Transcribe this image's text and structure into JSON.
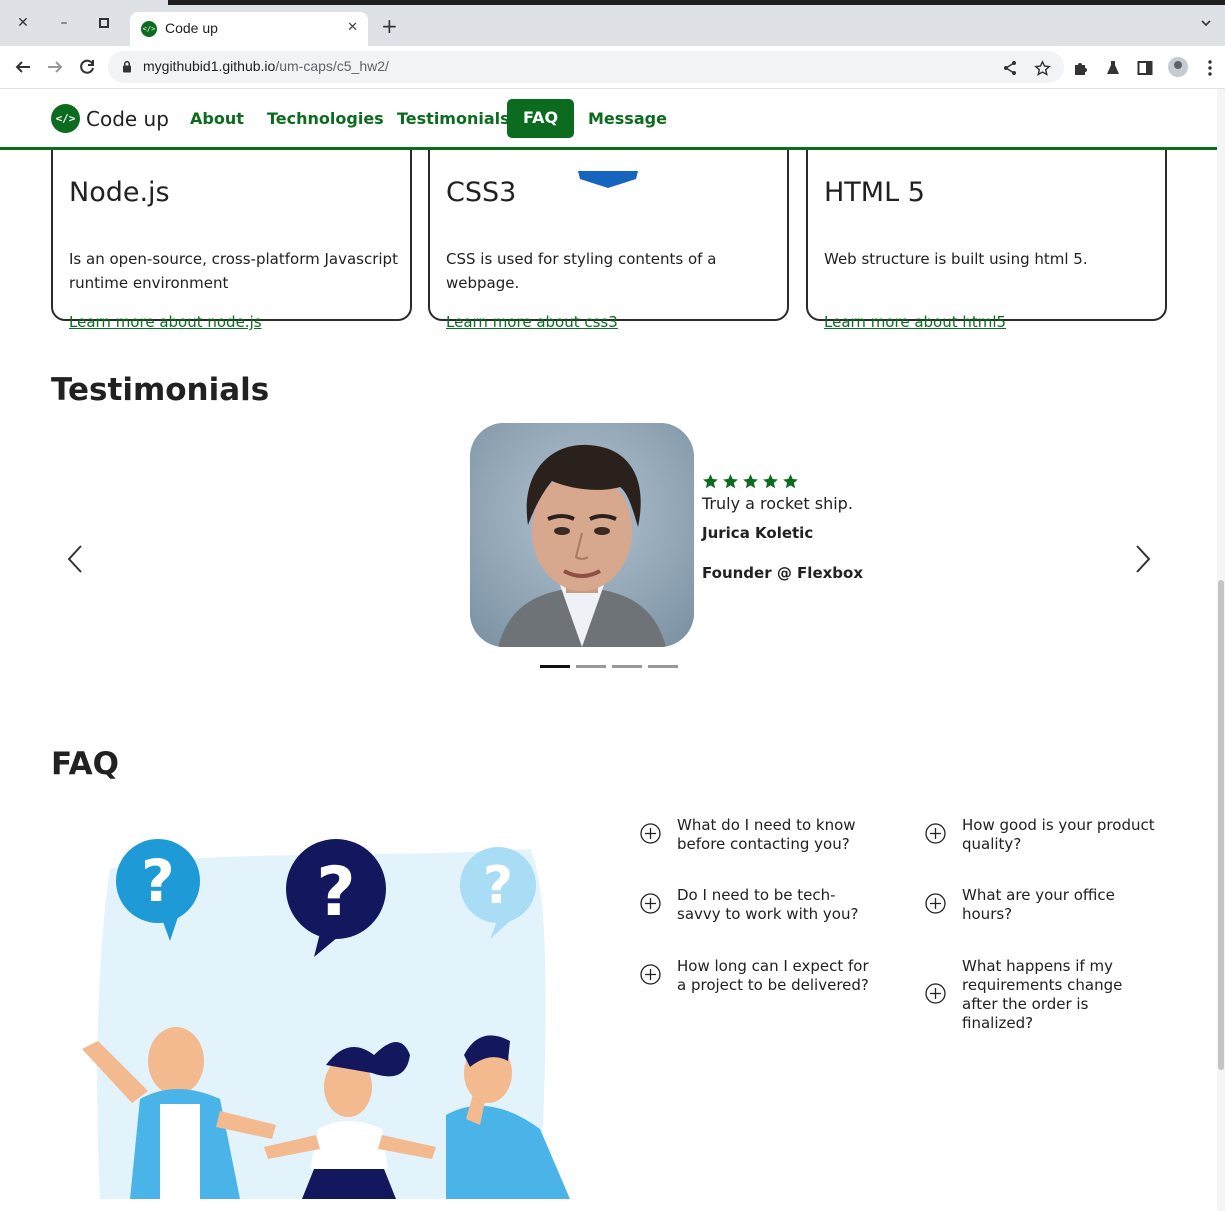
{
  "browser": {
    "tab_title": "Code up",
    "url_host": "mygithubid1.github.io",
    "url_path": "/um-caps/c5_hw2/"
  },
  "site": {
    "brand": "Code up",
    "brand_logo_text": "</>",
    "nav": [
      "About",
      "Technologies",
      "Testimonials",
      "FAQ",
      "Message"
    ],
    "active_nav": "FAQ",
    "accent": "#0b6b1f"
  },
  "technologies": [
    {
      "title": "Node.js",
      "description": "Is an open-source, cross-platform Javascript runtime environment",
      "link": "Learn more about node.js"
    },
    {
      "title": "CSS3",
      "description": "CSS is used for styling contents of a webpage.",
      "link": "Learn more about css3"
    },
    {
      "title": "HTML 5",
      "description": "Web structure is built using html 5.",
      "link": "Learn more about html5"
    }
  ],
  "testimonials": {
    "heading": "Testimonials",
    "rating": 5,
    "quote": "Truly a rocket ship.",
    "name": "Jurica Koletic",
    "role": "Founder @ Flexbox",
    "slide_count": 4,
    "active_slide": 1
  },
  "faq": {
    "heading": "FAQ",
    "questions": [
      "What do I need to know before contacting you?",
      "How good is your product quality?",
      "Do I need to be tech-savvy to work with you?",
      "What are your office hours?",
      "How long can I expect for a project to be delivered?",
      "What happens if my requirements change after the order is finalized?"
    ]
  }
}
